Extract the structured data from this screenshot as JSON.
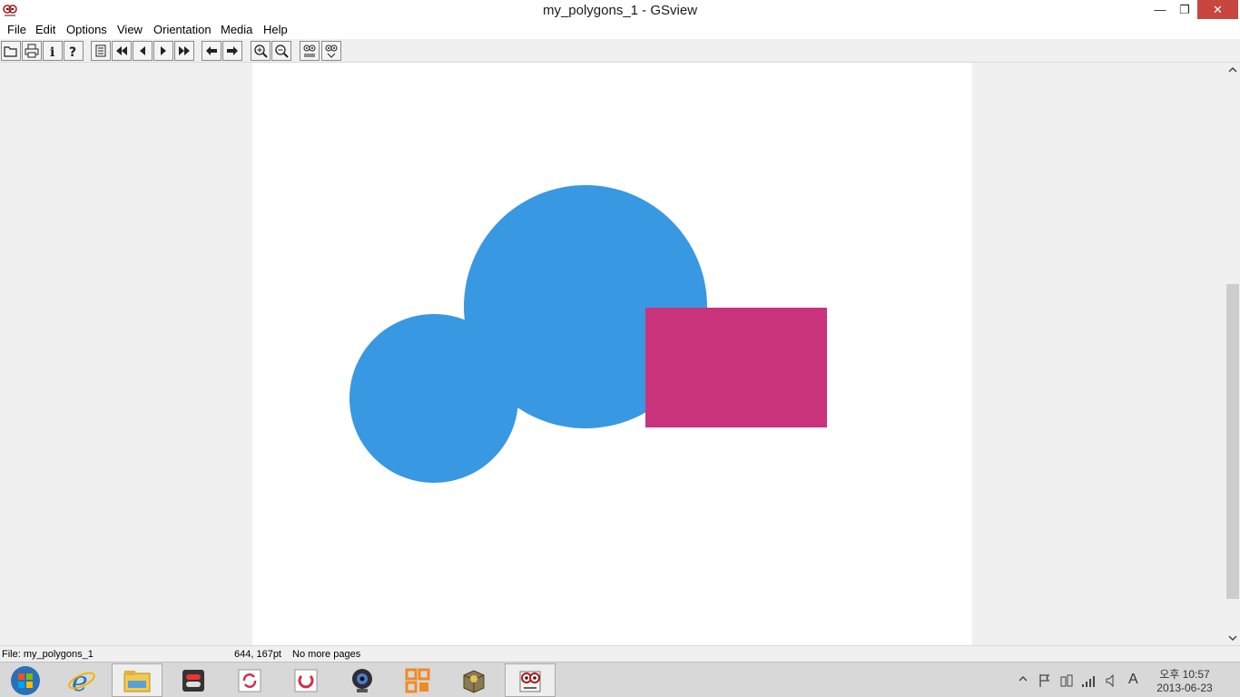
{
  "window": {
    "title": "my_polygons_1 - GSview",
    "minimize_glyph": "—",
    "restore_glyph": "❐",
    "close_glyph": "✕"
  },
  "menu": [
    "File",
    "Edit",
    "Options",
    "View",
    "Orientation",
    "Media",
    "Help"
  ],
  "toolbar": {
    "buttons": [
      "open-icon",
      "print-icon",
      "info-icon",
      "help-icon",
      "goto-page-icon",
      "first-page-icon",
      "previous-page-icon",
      "next-page-icon",
      "last-page-icon",
      "back-icon",
      "forward-icon",
      "zoom-in-icon",
      "zoom-out-icon",
      "find-text-icon",
      "find-next-icon"
    ]
  },
  "document": {
    "shapes": [
      {
        "kind": "circle",
        "name": "large-blue-circle",
        "color": "#3898e2"
      },
      {
        "kind": "circle",
        "name": "small-blue-circle",
        "color": "#3898e2"
      },
      {
        "kind": "rect",
        "name": "magenta-rectangle",
        "color": "#c9337c"
      }
    ]
  },
  "status": {
    "file": "File: my_polygons_1",
    "coords": "644, 167pt",
    "pages": "No more pages"
  },
  "taskbar": {
    "apps": [
      "start-button",
      "internet-explorer-icon",
      "file-explorer-icon",
      "settings-toggle-icon",
      "sync-icon",
      "restart-icon",
      "webcam-icon",
      "office-icon",
      "package-icon",
      "gsview-icon"
    ],
    "clock_time": "오후 10:57",
    "clock_date": "2013-06-23",
    "ime": "A"
  }
}
